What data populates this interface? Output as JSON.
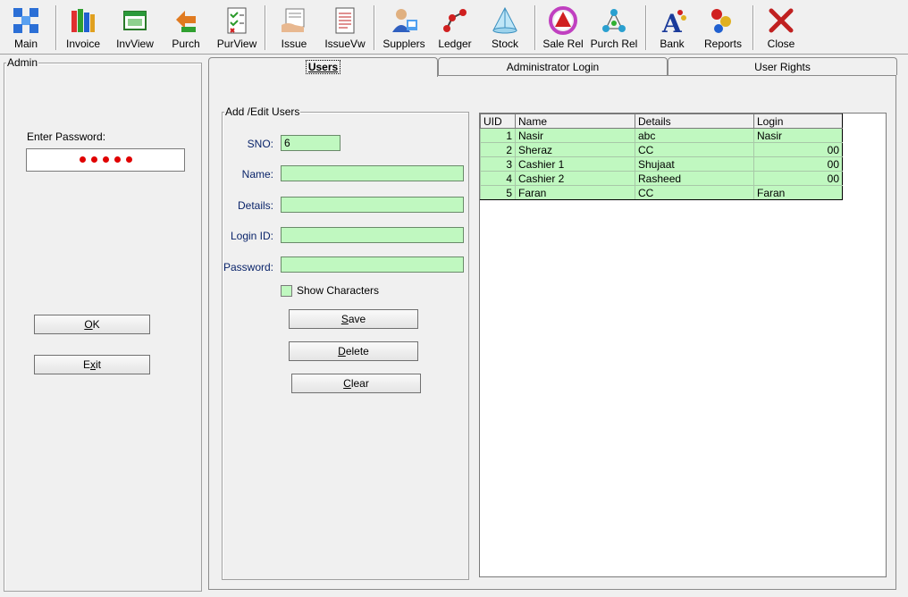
{
  "toolbar": [
    {
      "id": "main",
      "label": "Main",
      "icon": "main-grid-icon"
    },
    {
      "id": "invoice",
      "label": "Invoice",
      "icon": "invoice-books-icon"
    },
    {
      "id": "invview",
      "label": "InvView",
      "icon": "invview-window-icon"
    },
    {
      "id": "purch",
      "label": "Purch",
      "icon": "purch-arrows-icon"
    },
    {
      "id": "purview",
      "label": "PurView",
      "icon": "purview-checklist-icon"
    },
    {
      "id": "issue",
      "label": "Issue",
      "icon": "issue-hand-icon"
    },
    {
      "id": "issuevw",
      "label": "IssueVw",
      "icon": "issuevw-document-icon"
    },
    {
      "id": "suppliers",
      "label": "Supplers",
      "icon": "suppliers-person-icon"
    },
    {
      "id": "ledger",
      "label": "Ledger",
      "icon": "ledger-nodes-icon"
    },
    {
      "id": "stock",
      "label": "Stock",
      "icon": "stock-pyramid-icon"
    },
    {
      "id": "salerel",
      "label": "Sale Rel",
      "icon": "salerel-wheel-icon"
    },
    {
      "id": "purchrel",
      "label": "Purch Rel",
      "icon": "purchrel-network-icon"
    },
    {
      "id": "bank",
      "label": "Bank",
      "icon": "bank-letter-icon"
    },
    {
      "id": "reports",
      "label": "Reports",
      "icon": "reports-balls-icon"
    },
    {
      "id": "close",
      "label": "Close",
      "icon": "close-x-icon"
    }
  ],
  "admin": {
    "title": "Admin",
    "password_label": "Enter Password:",
    "password_mask_count": 5,
    "ok_label": "OK",
    "ok_accel": "O",
    "exit_label": "Exit",
    "exit_accel": "x"
  },
  "tabs": [
    {
      "label": "Users",
      "active": true
    },
    {
      "label": "Administrator Login",
      "active": false
    },
    {
      "label": "User Rights",
      "active": false
    }
  ],
  "form": {
    "title": "Add /Edit Users",
    "sno_label": "SNO:",
    "sno_value": "6",
    "name_label": "Name:",
    "name_value": "",
    "details_label": "Details:",
    "details_value": "",
    "login_label": "Login ID:",
    "login_value": "",
    "password_label": "Password:",
    "password_value": "",
    "show_chars_label": "Show Characters",
    "save_label": "Save",
    "save_accel": "S",
    "delete_label": "Delete",
    "delete_accel": "D",
    "clear_label": "Clear",
    "clear_accel": "C"
  },
  "grid": {
    "columns": [
      "UID",
      "Name",
      "Details",
      "Login"
    ],
    "rows": [
      [
        "1",
        "Nasir",
        "abc",
        "Nasir"
      ],
      [
        "2",
        "Sheraz",
        "CC",
        "00"
      ],
      [
        "3",
        "Cashier 1",
        "Shujaat",
        "00"
      ],
      [
        "4",
        "Cashier 2",
        "Rasheed",
        "00"
      ],
      [
        "5",
        "Faran",
        "CC",
        "Faran"
      ]
    ]
  },
  "colors": {
    "field_bg": "#c0f8c0",
    "password_dot": "#e00000",
    "label_text": "#0a246a"
  }
}
